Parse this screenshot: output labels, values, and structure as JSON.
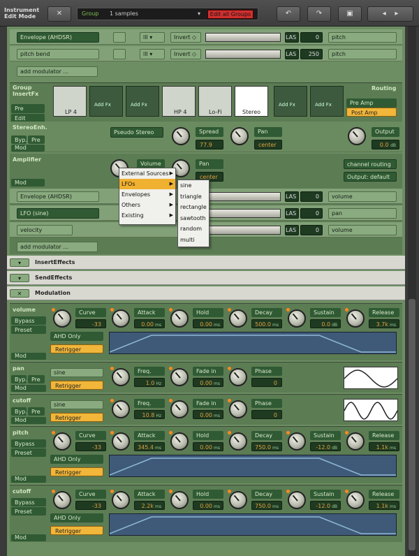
{
  "app": {
    "title_line1": "Instrument",
    "title_line2": "Edit Mode"
  },
  "toolbar": {
    "close_label": "✕",
    "group_label": "Group",
    "samples_label": "1 samples",
    "edit_all_label": "Edit all Groups"
  },
  "mod_rows_top": [
    {
      "source": "Envelope (AHDSR)",
      "invert": "Invert ◇",
      "las": "LAS",
      "value": "0",
      "target": "pitch"
    },
    {
      "source": "pitch bend",
      "invert": "Invert ◇",
      "las": "LAS",
      "value": "250",
      "target": "pitch"
    }
  ],
  "add_modulator": "add modulator ...",
  "group_insert": {
    "title": "Group InsertFx",
    "pre": "Pre",
    "edit": "Edit",
    "slots": [
      "LP 4",
      "Add Fx",
      "Add Fx",
      "HP 4",
      "Lo-Fi",
      "Stereo",
      "Add Fx",
      "Add Fx"
    ],
    "routing_title": "Routing",
    "pre_amp": "Pre Amp",
    "post_amp": "Post Amp"
  },
  "stereo_enh": {
    "title": "StereoEnh.",
    "byp": "Byp.",
    "pre": "Pre",
    "mod": "Mod",
    "mode": "Pseudo Stereo",
    "spread_label": "Spread",
    "spread_value": "77.9",
    "pan_label": "Pan",
    "pan_value": "center",
    "output_label": "Output",
    "output_value": "0.0",
    "output_unit": "dB"
  },
  "amplifier": {
    "title": "Amplifier",
    "mod": "Mod",
    "volume_label": "Volume",
    "pan_label": "Pan",
    "pan_value": "center",
    "channel_routing": "channel routing",
    "output": "Output: default"
  },
  "amp_rows": [
    {
      "source": "Envelope (AHDSR)",
      "las": "LAS",
      "value": "0",
      "target": "volume"
    },
    {
      "source": "LFO (sine)",
      "las": "LAS",
      "value": "0",
      "target": "pan"
    },
    {
      "source": "velocity",
      "las": "LAS",
      "value": "0",
      "target": "volume"
    }
  ],
  "menu": {
    "items": [
      "External Sources",
      "LFOs",
      "Envelopes",
      "Others",
      "Existing"
    ],
    "submenu": [
      "sine",
      "triangle",
      "rectangle",
      "sawtooth",
      "random",
      "multi"
    ]
  },
  "sections": {
    "insert": "InsertEffects",
    "send": "SendEffects",
    "modulation": "Modulation"
  },
  "modules": [
    {
      "name": "volume",
      "side": [
        "Bypass",
        "Preset"
      ],
      "mod": "Mod",
      "opt1": "AHD Only",
      "opt2": "Retrigger",
      "knobs": [
        [
          "Curve",
          "-33",
          ""
        ],
        [
          "Attack",
          "0.00",
          "ms"
        ],
        [
          "Hold",
          "0.00",
          "ms"
        ],
        [
          "Decay",
          "500.0",
          "ms"
        ],
        [
          "Sustain",
          "0.0",
          "dB"
        ],
        [
          "Release",
          "3.7k",
          "ms"
        ]
      ]
    },
    {
      "name": "pan",
      "side": [
        "Byp.",
        "Pre"
      ],
      "mod": "Mod",
      "opt1": "sine",
      "opt2": "Retrigger",
      "knobs": [
        [
          "Freq.",
          "1.0",
          "Hz"
        ],
        [
          "Fade in",
          "0.00",
          "ms"
        ],
        [
          "Phase",
          "0",
          ""
        ]
      ]
    },
    {
      "name": "cutoff",
      "side": [
        "Byp.",
        "Pre"
      ],
      "mod": "Mod",
      "opt1": "sine",
      "opt2": "Retrigger",
      "knobs": [
        [
          "Freq.",
          "10.8",
          "Hz"
        ],
        [
          "Fade in",
          "0.00",
          "ms"
        ],
        [
          "Phase",
          "0",
          ""
        ]
      ]
    },
    {
      "name": "pitch",
      "side": [
        "Bypass",
        "Preset"
      ],
      "mod": "Mod",
      "opt1": "AHD Only",
      "opt2": "Retrigger",
      "knobs": [
        [
          "Curve",
          "-33",
          ""
        ],
        [
          "Attack",
          "345.4",
          "ms"
        ],
        [
          "Hold",
          "0.00",
          "ms"
        ],
        [
          "Decay",
          "750.0",
          "ms"
        ],
        [
          "Sustain",
          "-12.0",
          "dB"
        ],
        [
          "Release",
          "1.1k",
          "ms"
        ]
      ]
    },
    {
      "name": "cutoff",
      "side": [
        "Bypass",
        "Preset"
      ],
      "mod": "Mod",
      "opt1": "AHD Only",
      "opt2": "Retrigger",
      "knobs": [
        [
          "Curve",
          "-33",
          ""
        ],
        [
          "Attack",
          "2.2k",
          "ms"
        ],
        [
          "Hold",
          "0.00",
          "ms"
        ],
        [
          "Decay",
          "750.0",
          "ms"
        ],
        [
          "Sustain",
          "-12.0",
          "dB"
        ],
        [
          "Release",
          "1.1k",
          "ms"
        ]
      ]
    }
  ]
}
